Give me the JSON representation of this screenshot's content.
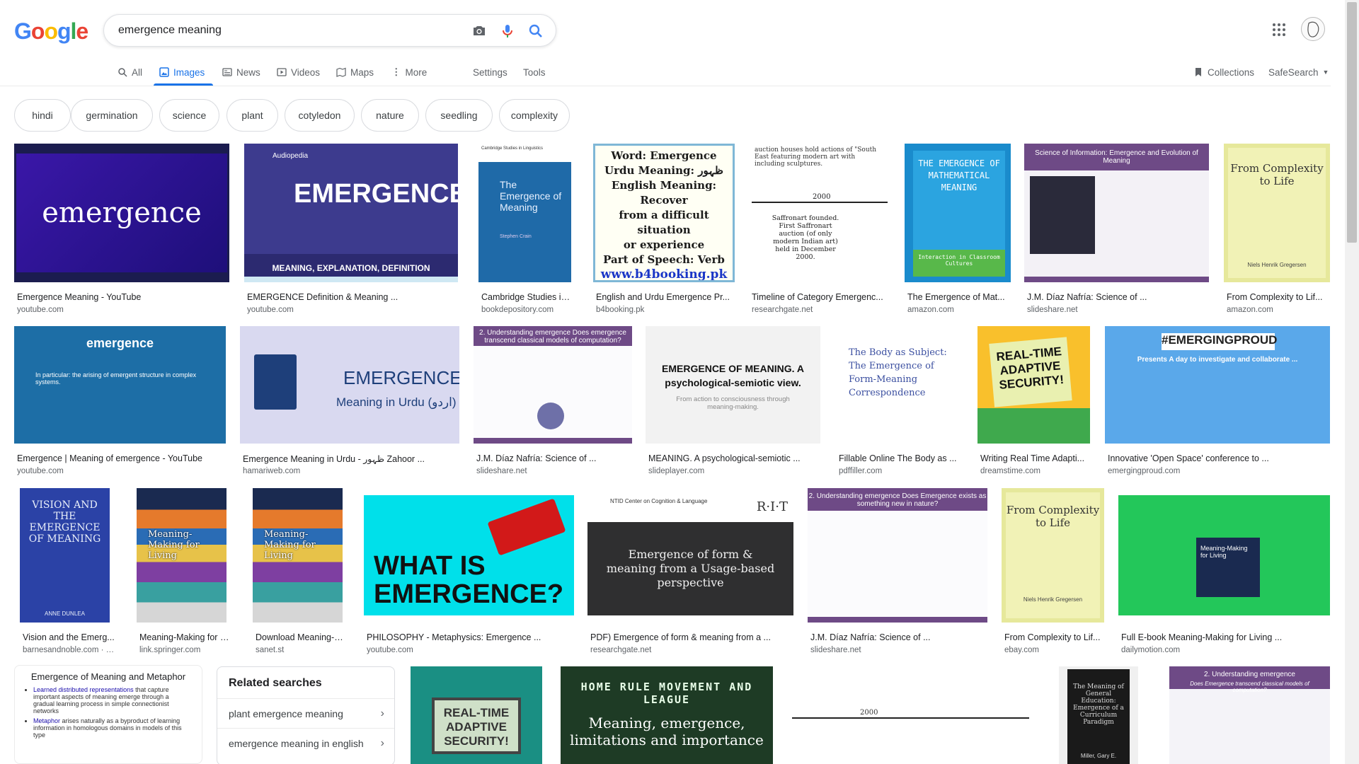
{
  "search": {
    "query": "emergence meaning"
  },
  "logo_letters": [
    {
      "ch": "G",
      "color": "#4285f4"
    },
    {
      "ch": "o",
      "color": "#ea4335"
    },
    {
      "ch": "o",
      "color": "#fbbc05"
    },
    {
      "ch": "g",
      "color": "#4285f4"
    },
    {
      "ch": "l",
      "color": "#34a853"
    },
    {
      "ch": "e",
      "color": "#ea4335"
    }
  ],
  "tabs": {
    "all": "All",
    "images": "Images",
    "news": "News",
    "videos": "Videos",
    "maps": "Maps",
    "more": "More",
    "settings": "Settings",
    "tools": "Tools",
    "collections": "Collections",
    "safesearch": "SafeSearch"
  },
  "chips": [
    "hindi",
    "germination",
    "science",
    "plant",
    "cotyledon",
    "nature",
    "seedling",
    "complexity"
  ],
  "results": [
    {
      "caption": "Emergence Meaning - YouTube",
      "source": "youtube.com",
      "thumb_text": "emergence"
    },
    {
      "caption": "EMERGENCE Definition & Meaning ...",
      "source": "youtube.com",
      "thumb_text": "EMERGENCE",
      "thumb_sub": "MEANING, EXPLANATION, DEFINITION",
      "thumb_tag": "Audiopedia"
    },
    {
      "caption": "Cambridge Studies in ...",
      "source": "bookdepository.com",
      "thumb_text": "The Emergence of Meaning",
      "thumb_sub": "Stephen Crain",
      "thumb_tag": "Cambridge Studies in Linguistics"
    },
    {
      "caption": "English and Urdu Emergence Pr...",
      "source": "b4booking.pk",
      "thumb_lines": [
        "Word: Emergence",
        "Urdu Meaning: ظہور",
        "English Meaning: Recover",
        "from a difficult situation",
        "or experience",
        "Part of Speech: Verb",
        "www.b4booking.pk"
      ]
    },
    {
      "caption": "Timeline of Category Emergenc...",
      "source": "researchgate.net",
      "thumb_text": "2000",
      "thumb_sub": "Saffronart founded. First Saffronart auction (of only modern Indian art) held in December 2000."
    },
    {
      "caption": "The Emergence of Mat...",
      "source": "amazon.com",
      "thumb_text": "THE EMERGENCE OF MATHEMATICAL MEANING",
      "thumb_sub": "Interaction in Classroom Cultures"
    },
    {
      "caption": "J.M. Díaz Nafría: Science of ...",
      "source": "slideshare.net",
      "thumb_text": "Science of Information: Emergence and Evolution of Meaning"
    },
    {
      "caption": "From Complexity to Lif...",
      "source": "amazon.com",
      "thumb_text": "From Complexity to Life",
      "thumb_sub": "Niels Henrik Gregersen"
    },
    {
      "caption": "Emergence | Meaning of emergence - YouTube",
      "source": "youtube.com",
      "thumb_text": "emergence",
      "thumb_sub": "In particular: the arising of emergent structure in complex systems."
    },
    {
      "caption": "Emergence Meaning in Urdu - ظہور Zahoor ...",
      "source": "hamariweb.com",
      "thumb_text": "EMERGENCE",
      "thumb_sub": "Meaning in Urdu (اردو)"
    },
    {
      "caption": "J.M. Díaz Nafría: Science of ...",
      "source": "slideshare.net",
      "thumb_text": "2. Understanding emergence",
      "thumb_sub": "Does emergence transcend classical models of computation?"
    },
    {
      "caption": "MEANING. A psychological-semiotic ...",
      "source": "slideplayer.com",
      "thumb_text": "EMERGENCE OF MEANING. A psychological-semiotic view.",
      "thumb_sub": "From action to consciousness through meaning-making."
    },
    {
      "caption": "Fillable Online The Body as ...",
      "source": "pdffiller.com",
      "thumb_text": "The Body as Subject: The Emergence of Form-Meaning Correspondence"
    },
    {
      "caption": "Writing Real Time Adapti...",
      "source": "dreamstime.com",
      "thumb_text": "REAL-TIME ADAPTIVE SECURITY!"
    },
    {
      "caption": "Innovative 'Open Space' conference to ...",
      "source": "emergingproud.com",
      "thumb_text": "#EMERGINGPROUD",
      "thumb_sub": "Presents A day to investigate and collaborate ..."
    },
    {
      "caption": "Vision and the Emerg...",
      "source": "barnesandnoble.com · I...",
      "thumb_text": "VISION AND THE EMERGENCE OF MEANING",
      "thumb_sub": "ANNE DUNLEA"
    },
    {
      "caption": "Meaning-Making for Li...",
      "source": "link.springer.com",
      "thumb_text": "Meaning-Making for Living"
    },
    {
      "caption": "Download Meaning-M...",
      "source": "sanet.st",
      "thumb_text": "Meaning-Making for Living"
    },
    {
      "caption": "PHILOSOPHY - Metaphysics: Emergence ...",
      "source": "youtube.com",
      "thumb_text": "WHAT IS EMERGENCE?"
    },
    {
      "caption": "PDF) Emergence of form & meaning from a ...",
      "source": "researchgate.net",
      "thumb_text": "Emergence of form & meaning from a Usage-based perspective",
      "thumb_tag": "NTID Center on Cognition & Language",
      "thumb_sub": "R·I·T"
    },
    {
      "caption": "J.M. Díaz Nafría: Science of ...",
      "source": "slideshare.net",
      "thumb_text": "2. Understanding emergence",
      "thumb_sub": "Does Emergence exists as something new in nature?"
    },
    {
      "caption": "From Complexity to Lif...",
      "source": "ebay.com",
      "thumb_text": "From Complexity to Life",
      "thumb_sub": "Niels Henrik Gregersen"
    },
    {
      "caption": "Full E-book Meaning-Making for Living ...",
      "source": "dailymotion.com",
      "thumb_text": "Meaning-Making for Living"
    }
  ],
  "row4": {
    "text_card": {
      "title": "Emergence of Meaning and Metaphor",
      "items": [
        {
          "link": "Learned distributed representations",
          "rest": " that capture important aspects of meaning emerge through a gradual learning process in simple connectionist networks"
        },
        {
          "link": "Metaphor",
          "rest": " arises naturally as a byproduct of learning information in homologous domains in models of this type"
        }
      ]
    },
    "related": {
      "title": "Related searches",
      "items": [
        "plant emergence meaning",
        "emergence meaning in english"
      ]
    },
    "thumbs": [
      {
        "text": "REAL-TIME ADAPTIVE SECURITY!"
      },
      {
        "text": "HOME RULE MOVEMENT AND LEAGUE",
        "sub": "Meaning, emergence, limitations and importance"
      },
      {
        "text": "2000"
      },
      {
        "text": "The Meaning of General Education: Emergence of a Curriculum Paradigm",
        "sub": "Miller, Gary E."
      },
      {
        "text": "2. Understanding emergence",
        "sub": "Does Emergence transcend classical models of computation?"
      }
    ]
  },
  "colors": {
    "accent": "#1a73e8",
    "text_secondary": "#5f6368"
  }
}
